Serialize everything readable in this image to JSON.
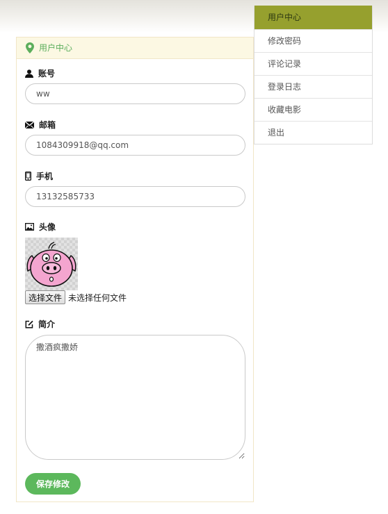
{
  "sidebar": {
    "items": [
      {
        "label": "用户中心",
        "active": true
      },
      {
        "label": "修改密码"
      },
      {
        "label": "评论记录"
      },
      {
        "label": "登录日志"
      },
      {
        "label": "收藏电影"
      },
      {
        "label": "退出"
      }
    ]
  },
  "panel": {
    "title": "用户中心",
    "account": {
      "label": "账号",
      "value": "ww"
    },
    "email": {
      "label": "邮箱",
      "value": "1084309918@qq.com"
    },
    "phone": {
      "label": "手机",
      "value": "13132585733"
    },
    "avatar": {
      "label": "头像",
      "file_button": "选择文件",
      "file_status": "未选择任何文件"
    },
    "bio": {
      "label": "简介",
      "value": "撒酒疯撒娇"
    },
    "save_label": "保存修改"
  },
  "colors": {
    "accent": "#96a02e",
    "success": "#5cb85c",
    "panel_header_bg": "#fcf8e3",
    "panel_header_text": "#5cae5c"
  }
}
